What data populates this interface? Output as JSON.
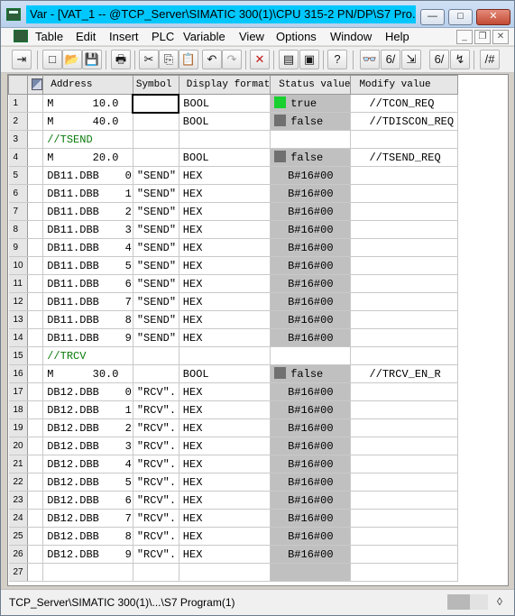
{
  "window": {
    "title": "Var - [VAT_1 -- @TCP_Server\\SIMATIC 300(1)\\CPU 315-2 PN/DP\\S7 Pro...",
    "minimize_glyph": "—",
    "maximize_glyph": "□",
    "close_glyph": "✕"
  },
  "menu": {
    "items": [
      "Table",
      "Edit",
      "Insert",
      "PLC",
      "Variable",
      "View",
      "Options",
      "Window",
      "Help"
    ],
    "mdi_min": "_",
    "mdi_restore": "❐",
    "mdi_close": "✕"
  },
  "toolbar": {
    "icons": [
      "pin-icon",
      "new-icon",
      "open-icon",
      "save-icon",
      "print-icon",
      "cut-icon",
      "copy-icon",
      "paste-icon",
      "undo-icon",
      "redo-icon",
      "delete-icon",
      "monitor-icon",
      "plc-icon",
      "help-icon",
      "glasses-icon",
      "monitor-variable-icon",
      "trigger-icon",
      "modify-icon",
      "force-icon",
      "tools-icon"
    ],
    "glyphs": [
      "⇥",
      "□",
      "📂",
      "💾",
      "🖶",
      "✂",
      "⎘",
      "📋",
      "↶",
      "↷",
      "✕",
      "▤",
      "▣",
      "?",
      "👓",
      "6/",
      "⇲",
      "6/",
      "↯",
      "/#"
    ]
  },
  "table": {
    "headers": {
      "address": "Address",
      "symbol": "Symbol",
      "display_format": "Display format",
      "status_value": "Status value",
      "modify_value": "Modify value"
    },
    "rows": [
      {
        "num": "1",
        "address": "M      10.0",
        "symbol": "",
        "format": "BOOL",
        "indicator": "green",
        "status": "true",
        "modify": "//TCON_REQ",
        "kind": "bool",
        "focused": true
      },
      {
        "num": "2",
        "address": "M      40.0",
        "symbol": "",
        "format": "BOOL",
        "indicator": "gray",
        "status": "false",
        "modify": "//TDISCON_REQ",
        "kind": "bool"
      },
      {
        "num": "3",
        "address": "//TSEND",
        "symbol": "",
        "format": "",
        "indicator": "",
        "status": "",
        "modify": "",
        "kind": "comment"
      },
      {
        "num": "4",
        "address": "M      20.0",
        "symbol": "",
        "format": "BOOL",
        "indicator": "gray",
        "status": "false",
        "modify": "//TSEND_REQ",
        "kind": "bool"
      },
      {
        "num": "5",
        "address": "DB11.DBB    0",
        "symbol": "\"SEND\"",
        "format": "HEX",
        "status": "B#16#00",
        "modify": "",
        "kind": "hex"
      },
      {
        "num": "6",
        "address": "DB11.DBB    1",
        "symbol": "\"SEND\"",
        "format": "HEX",
        "status": "B#16#00",
        "modify": "",
        "kind": "hex"
      },
      {
        "num": "7",
        "address": "DB11.DBB    2",
        "symbol": "\"SEND\"",
        "format": "HEX",
        "status": "B#16#00",
        "modify": "",
        "kind": "hex"
      },
      {
        "num": "8",
        "address": "DB11.DBB    3",
        "symbol": "\"SEND\"",
        "format": "HEX",
        "status": "B#16#00",
        "modify": "",
        "kind": "hex"
      },
      {
        "num": "9",
        "address": "DB11.DBB    4",
        "symbol": "\"SEND\"",
        "format": "HEX",
        "status": "B#16#00",
        "modify": "",
        "kind": "hex"
      },
      {
        "num": "10",
        "address": "DB11.DBB    5",
        "symbol": "\"SEND\"",
        "format": "HEX",
        "status": "B#16#00",
        "modify": "",
        "kind": "hex"
      },
      {
        "num": "11",
        "address": "DB11.DBB    6",
        "symbol": "\"SEND\"",
        "format": "HEX",
        "status": "B#16#00",
        "modify": "",
        "kind": "hex"
      },
      {
        "num": "12",
        "address": "DB11.DBB    7",
        "symbol": "\"SEND\"",
        "format": "HEX",
        "status": "B#16#00",
        "modify": "",
        "kind": "hex"
      },
      {
        "num": "13",
        "address": "DB11.DBB    8",
        "symbol": "\"SEND\"",
        "format": "HEX",
        "status": "B#16#00",
        "modify": "",
        "kind": "hex"
      },
      {
        "num": "14",
        "address": "DB11.DBB    9",
        "symbol": "\"SEND\"",
        "format": "HEX",
        "status": "B#16#00",
        "modify": "",
        "kind": "hex"
      },
      {
        "num": "15",
        "address": "//TRCV",
        "symbol": "",
        "format": "",
        "indicator": "",
        "status": "",
        "modify": "",
        "kind": "comment"
      },
      {
        "num": "16",
        "address": "M      30.0",
        "symbol": "",
        "format": "BOOL",
        "indicator": "gray",
        "status": "false",
        "modify": "//TRCV_EN_R",
        "kind": "bool"
      },
      {
        "num": "17",
        "address": "DB12.DBB    0",
        "symbol": "\"RCV\".",
        "format": "HEX",
        "status": "B#16#00",
        "modify": "",
        "kind": "hex"
      },
      {
        "num": "18",
        "address": "DB12.DBB    1",
        "symbol": "\"RCV\".",
        "format": "HEX",
        "status": "B#16#00",
        "modify": "",
        "kind": "hex"
      },
      {
        "num": "19",
        "address": "DB12.DBB    2",
        "symbol": "\"RCV\".",
        "format": "HEX",
        "status": "B#16#00",
        "modify": "",
        "kind": "hex"
      },
      {
        "num": "20",
        "address": "DB12.DBB    3",
        "symbol": "\"RCV\".",
        "format": "HEX",
        "status": "B#16#00",
        "modify": "",
        "kind": "hex"
      },
      {
        "num": "21",
        "address": "DB12.DBB    4",
        "symbol": "\"RCV\".",
        "format": "HEX",
        "status": "B#16#00",
        "modify": "",
        "kind": "hex"
      },
      {
        "num": "22",
        "address": "DB12.DBB    5",
        "symbol": "\"RCV\".",
        "format": "HEX",
        "status": "B#16#00",
        "modify": "",
        "kind": "hex"
      },
      {
        "num": "23",
        "address": "DB12.DBB    6",
        "symbol": "\"RCV\".",
        "format": "HEX",
        "status": "B#16#00",
        "modify": "",
        "kind": "hex"
      },
      {
        "num": "24",
        "address": "DB12.DBB    7",
        "symbol": "\"RCV\".",
        "format": "HEX",
        "status": "B#16#00",
        "modify": "",
        "kind": "hex"
      },
      {
        "num": "25",
        "address": "DB12.DBB    8",
        "symbol": "\"RCV\".",
        "format": "HEX",
        "status": "B#16#00",
        "modify": "",
        "kind": "hex"
      },
      {
        "num": "26",
        "address": "DB12.DBB    9",
        "symbol": "\"RCV\".",
        "format": "HEX",
        "status": "B#16#00",
        "modify": "",
        "kind": "hex"
      },
      {
        "num": "27",
        "address": "",
        "symbol": "",
        "format": "",
        "indicator": "",
        "status": "",
        "modify": "",
        "kind": "empty"
      }
    ]
  },
  "statusbar": {
    "path": "TCP_Server\\SIMATIC 300(1)\\...\\S7 Program(1)",
    "grip_glyph": "◊"
  },
  "colors": {
    "title_highlight": "#00c8ff",
    "indicator_true": "#18d030",
    "indicator_false": "#707070",
    "status_cell": "#c0c0c0",
    "comment_text": "#0a7a0a"
  }
}
